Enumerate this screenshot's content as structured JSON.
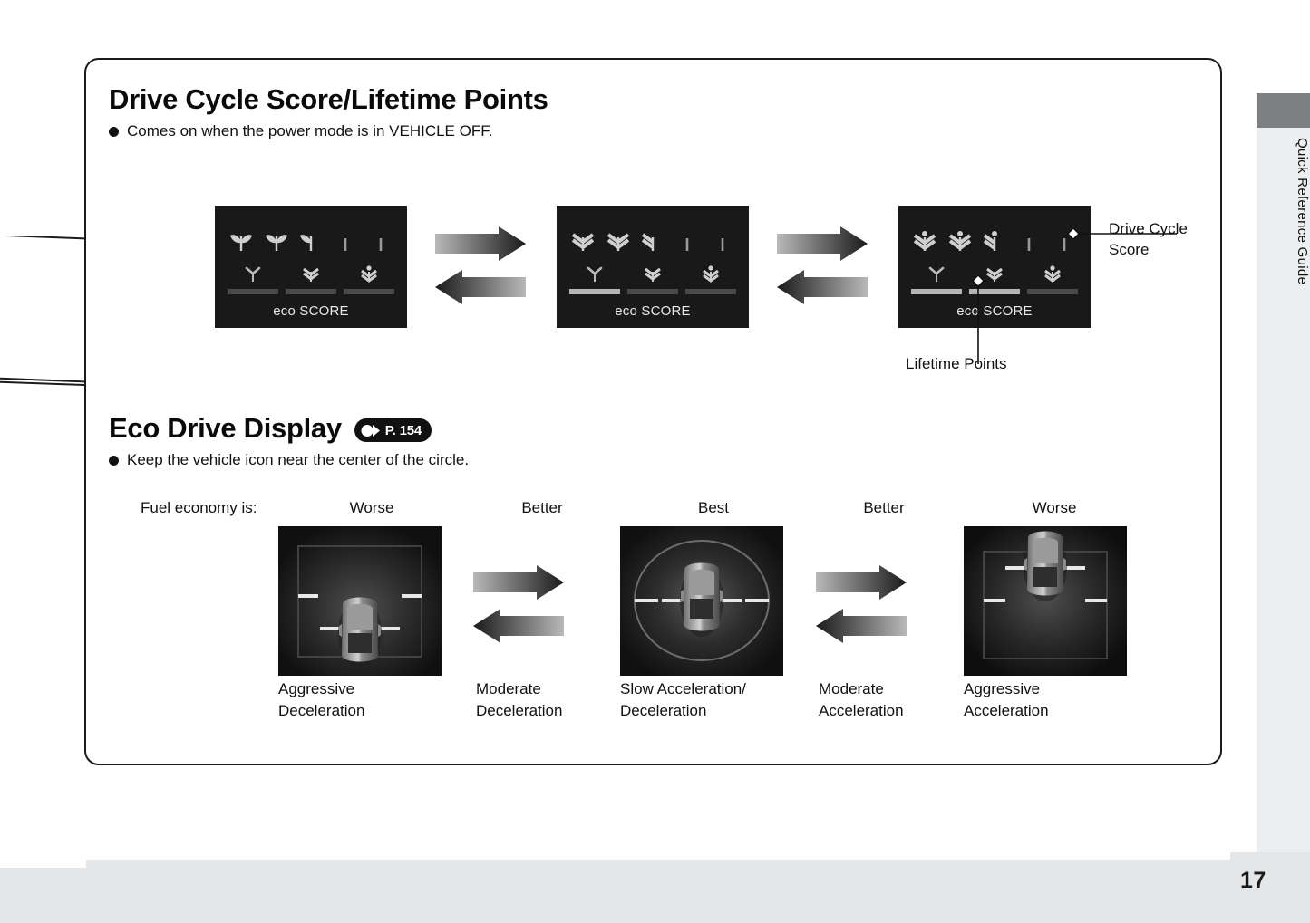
{
  "page": {
    "number": "17",
    "side_tab_label": "Quick Reference Guide"
  },
  "sections": [
    {
      "id": "drive-cycle-score",
      "title": "Drive Cycle Score/Lifetime Points",
      "bullet": "Comes on when the power mode is in VEHICLE OFF.",
      "eco_label": "eco SCORE",
      "callouts": {
        "drive_cycle_score": "Drive Cycle\nScore",
        "lifetime_points": "Lifetime Points"
      },
      "panels": [
        {
          "name": "eco-score-panel-low",
          "leaf_stage": 1,
          "bars_filled": 0
        },
        {
          "name": "eco-score-panel-medium",
          "leaf_stage": 2,
          "bars_filled": 1
        },
        {
          "name": "eco-score-panel-high",
          "leaf_stage": 3,
          "bars_filled": 2
        }
      ]
    },
    {
      "id": "eco-drive-display",
      "title": "Eco Drive Display",
      "page_ref": "P. 154",
      "bullet": "Keep the vehicle icon near the center of the circle.",
      "fuel_economy_prefix": "Fuel economy is:",
      "columns": [
        {
          "rating": "Worse",
          "caption": "Aggressive\nDeceleration",
          "car_position": "low",
          "ring": "rect-wide"
        },
        {
          "rating": "Better",
          "caption": "Moderate\nDeceleration",
          "car_position": null,
          "ring": null
        },
        {
          "rating": "Best",
          "caption": "Slow Acceleration/\nDeceleration",
          "car_position": "center",
          "ring": "circle"
        },
        {
          "rating": "Better",
          "caption": "Moderate\nAcceleration",
          "car_position": null,
          "ring": null
        },
        {
          "rating": "Worse",
          "caption": "Aggressive\nAcceleration",
          "car_position": "high",
          "ring": "rect-tall"
        }
      ]
    }
  ],
  "colors": {
    "panel_background": "#191919",
    "drive_panel_background": "#121212",
    "bar_empty": "#4a4a4a",
    "bar_filled": "#b5b5b5",
    "ink": "#111111",
    "footer_band": "#e4e6e8",
    "side_tab": "#eceef0",
    "side_tab_cap": "#7d7f81"
  }
}
